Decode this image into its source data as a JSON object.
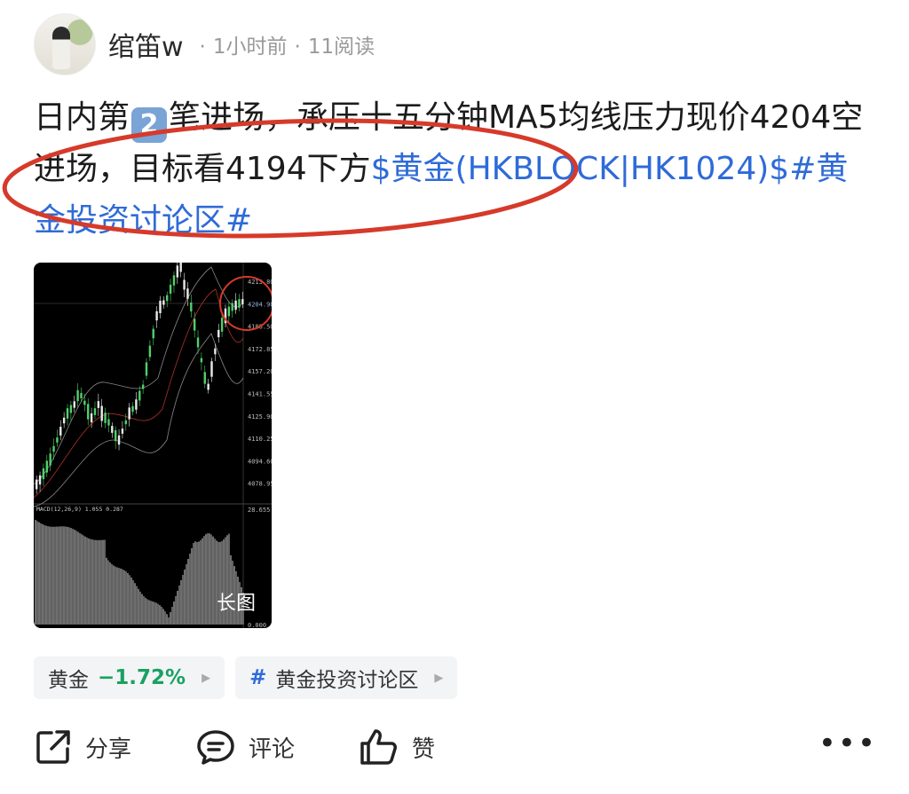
{
  "header": {
    "author": "绾笛w",
    "time": "1小时前",
    "reads": "11阅读"
  },
  "post": {
    "text_before": "日内第",
    "keycap": "2",
    "text_after": "笔进场，承压十五分钟MA5均线压力现价4204空进场，目标看4194下方",
    "stock_link": "$黄金(HKBLOCK|HK1024)$",
    "topic_link": "#黄金投资讨论区#"
  },
  "image": {
    "badge": "长图",
    "price_labels": [
      "4213.80",
      "4204.90",
      "4188.50",
      "4172.85",
      "4157.20",
      "4141.55",
      "4125.90",
      "4110.25",
      "4094.60",
      "4078.95"
    ],
    "macd_label": "MACD(12,26,9) 1.055 0.287",
    "macd_value": "28.655",
    "macd_zero": "0.000"
  },
  "tags": {
    "stock_name": "黄金",
    "stock_change": "−1.72%",
    "topic_name": "黄金投资讨论区"
  },
  "actions": {
    "share": "分享",
    "comment": "评论",
    "like": "赞",
    "more": "•••"
  },
  "colors": {
    "link": "#2f6bd8",
    "gain_green": "#1aa162",
    "annotation_red": "#d63a2a"
  }
}
